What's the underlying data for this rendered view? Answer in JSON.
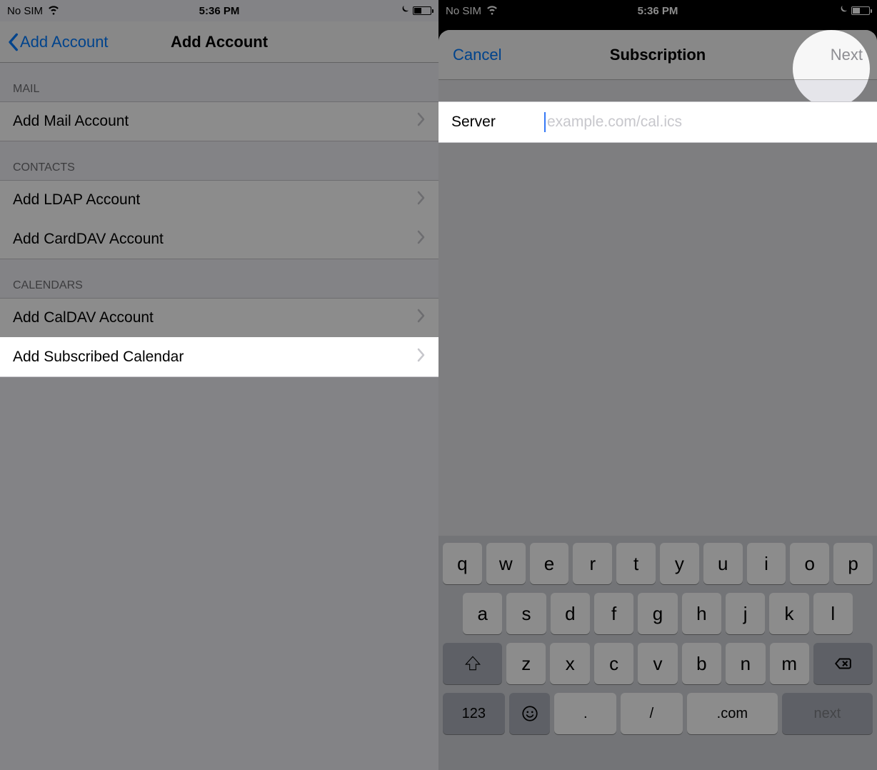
{
  "statusBar": {
    "carrier": "No SIM",
    "time": "5:36 PM"
  },
  "left": {
    "back": "Add Account",
    "title": "Add Account",
    "sections": [
      {
        "header": "MAIL",
        "rows": [
          "Add Mail Account"
        ]
      },
      {
        "header": "CONTACTS",
        "rows": [
          "Add LDAP Account",
          "Add CardDAV Account"
        ]
      },
      {
        "header": "CALENDARS",
        "rows": [
          "Add CalDAV Account",
          "Add Subscribed Calendar"
        ]
      }
    ]
  },
  "right": {
    "cancel": "Cancel",
    "title": "Subscription",
    "next": "Next",
    "serverLabel": "Server",
    "serverPlaceholder": "example.com/cal.ics"
  },
  "keyboard": {
    "r1": [
      "q",
      "w",
      "e",
      "r",
      "t",
      "y",
      "u",
      "i",
      "o",
      "p"
    ],
    "r2": [
      "a",
      "s",
      "d",
      "f",
      "g",
      "h",
      "j",
      "k",
      "l"
    ],
    "r3": [
      "z",
      "x",
      "c",
      "v",
      "b",
      "n",
      "m"
    ],
    "numKey": "123",
    "dot": ".",
    "slash": "/",
    "com": ".com",
    "nextKey": "next"
  }
}
